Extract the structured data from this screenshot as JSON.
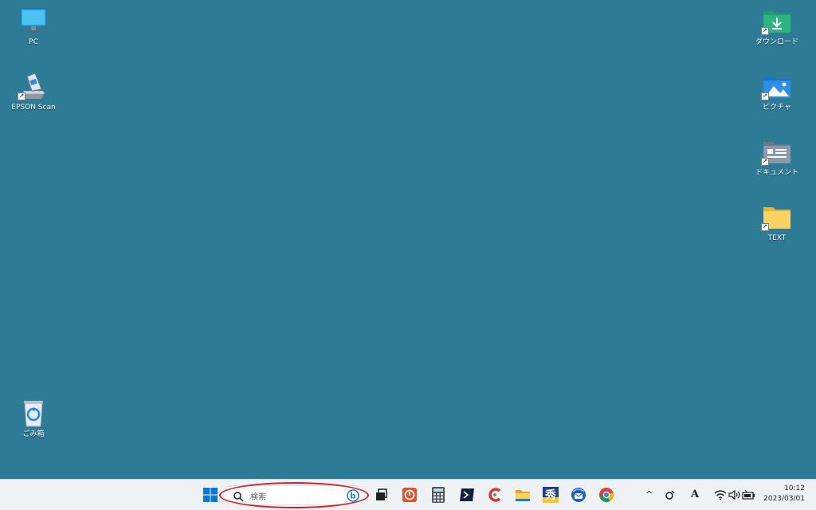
{
  "desktop": {
    "background": "#2e7b96",
    "icons_left": [
      {
        "label": "PC",
        "icon": "monitor-icon"
      },
      {
        "label": "EPSON Scan",
        "icon": "scanner-icon"
      },
      {
        "label": "ごみ箱",
        "icon": "recycle-bin-icon"
      }
    ],
    "icons_right": [
      {
        "label": "ダウンロード",
        "icon": "downloads-folder-icon"
      },
      {
        "label": "ピクチャ",
        "icon": "pictures-folder-icon"
      },
      {
        "label": "ドキュメント",
        "icon": "documents-folder-icon"
      },
      {
        "label": "TEXT",
        "icon": "folder-icon"
      }
    ]
  },
  "taskbar": {
    "start_icon": "windows-start-icon",
    "search": {
      "placeholder": "検索",
      "bing_icon": "bing-icon"
    },
    "highlight_color": "#d0202a",
    "pinned_apps": [
      "task-view-icon",
      "shutdown-app-icon",
      "calculator-icon",
      "terminal-icon",
      "ccleaner-icon",
      "file-explorer-icon",
      "japanese-app-icon",
      "thunderbird-icon",
      "chrome-icon"
    ],
    "tray": {
      "chevron": "^",
      "ime_indicator": "A",
      "icons": [
        "tray-app-icon",
        "wifi-icon",
        "volume-icon",
        "battery-icon"
      ]
    },
    "clock": {
      "time": "10:12",
      "date": "2023/03/01"
    }
  }
}
